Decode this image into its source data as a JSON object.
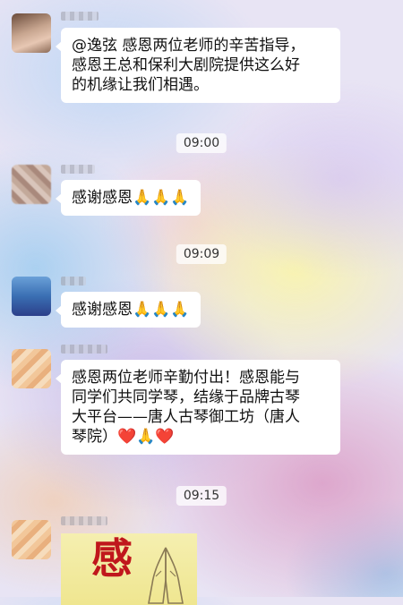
{
  "messages": [
    {
      "text": "@逸弦 感恩两位老师的辛苦指导，\n感恩王总和保利大剧院提供这么好\n的机缘让我们相遇。"
    },
    {
      "text": "感谢感恩🙏🙏🙏"
    },
    {
      "text": "感谢感恩🙏🙏🙏"
    },
    {
      "text": "感恩两位老师辛勤付出！感恩能与\n同学们共同学琴，结缘于品牌古琴\n大平台——唐人古琴御工坊（唐人\n琴院）❤️🙏❤️"
    }
  ],
  "timestamps": [
    "09:00",
    "09:09",
    "09:15"
  ],
  "image_card": {
    "char": "感"
  }
}
